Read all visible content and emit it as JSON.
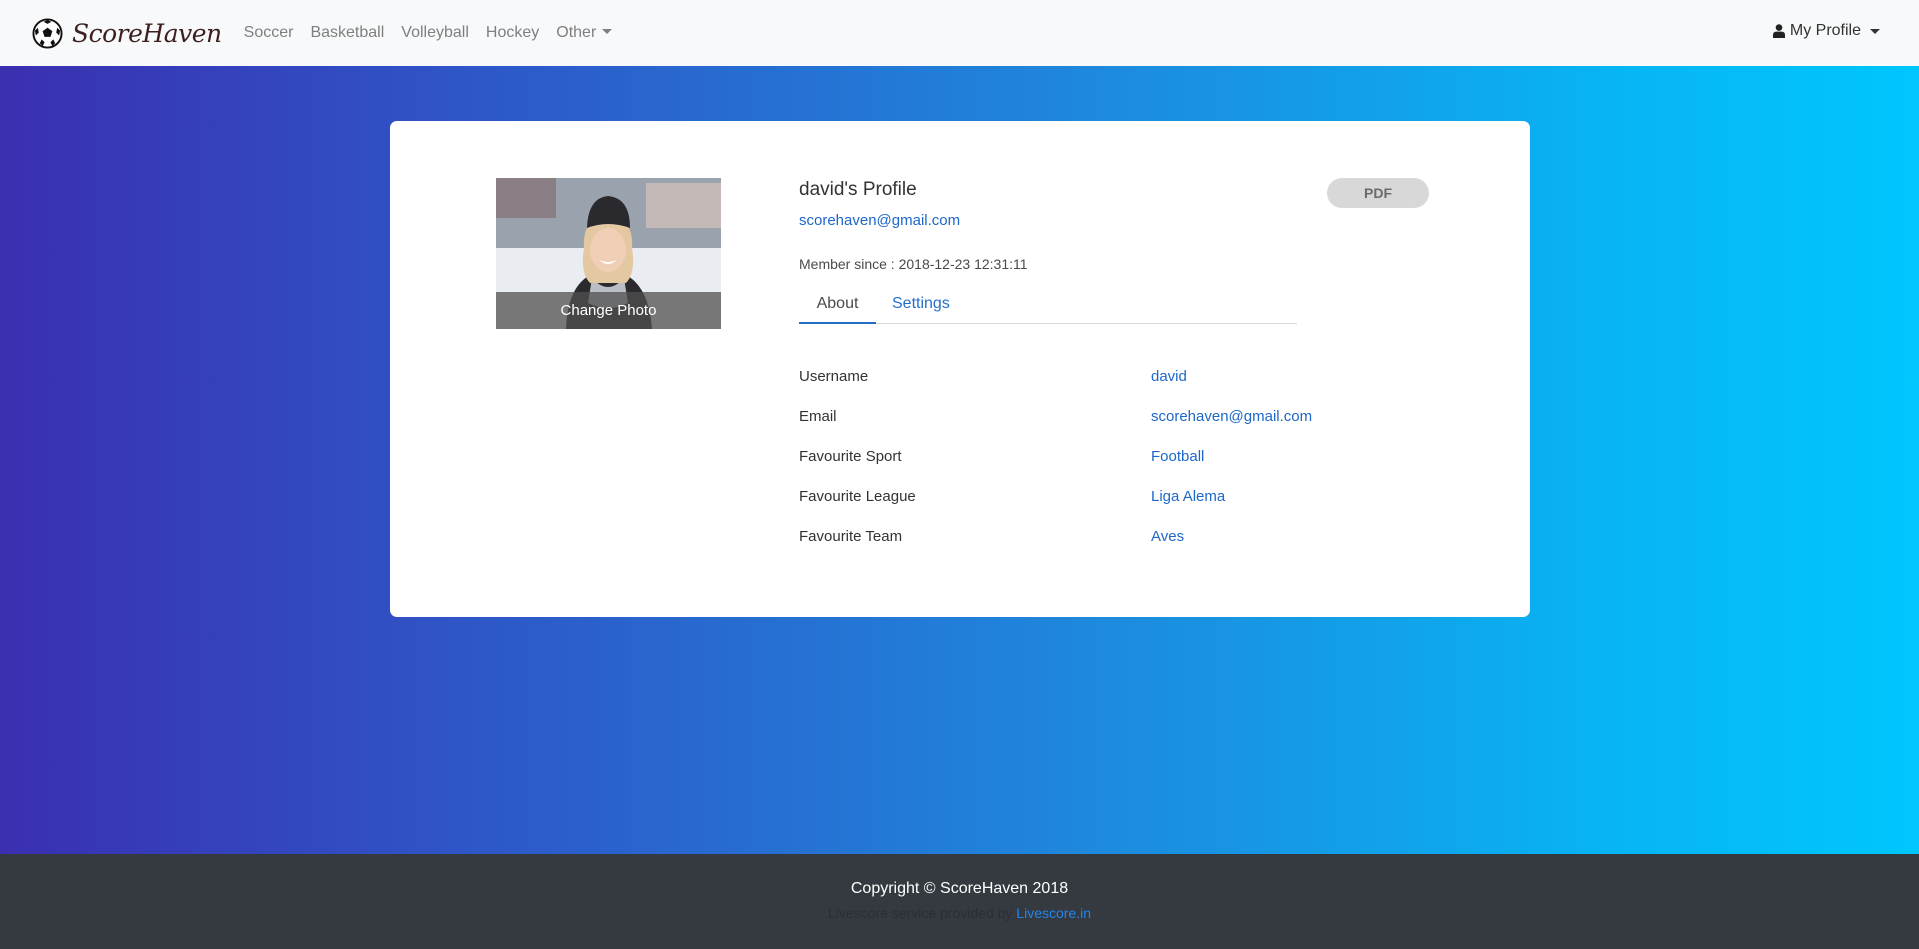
{
  "navbar": {
    "brand": "ScoreHaven",
    "links": [
      "Soccer",
      "Basketball",
      "Volleyball",
      "Hockey"
    ],
    "other_label": "Other",
    "profile_label": "My Profile"
  },
  "profile": {
    "photo_overlay": "Change Photo",
    "title": "david's Profile",
    "email": "scorehaven@gmail.com",
    "member_since": "Member since : 2018-12-23 12:31:11",
    "pdf_label": "PDF",
    "tabs": [
      "About",
      "Settings"
    ],
    "rows": [
      {
        "label": "Username",
        "value": "david"
      },
      {
        "label": "Email",
        "value": "scorehaven@gmail.com"
      },
      {
        "label": "Favourite Sport",
        "value": "Football"
      },
      {
        "label": "Favourite League",
        "value": "Liga Alema"
      },
      {
        "label": "Favourite Team",
        "value": "Aves"
      }
    ]
  },
  "footer": {
    "copyright": "Copyright © ScoreHaven 2018",
    "provided_text": "Livescore service provided by",
    "provider_link": "Livescore.in"
  },
  "colors": {
    "accent": "#1d67c9",
    "navbar_bg": "#f8f9fa",
    "footer_bg": "#353a40",
    "gradient_start": "#3a2fb0",
    "gradient_end": "#00c6fe"
  },
  "icons": {
    "brand": "soccer-ball-icon",
    "profile": "user-icon",
    "dropdown": "caret-down-icon"
  }
}
